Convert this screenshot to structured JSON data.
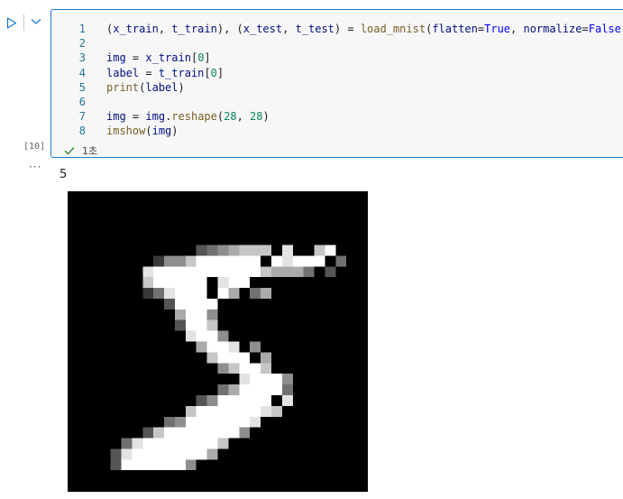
{
  "cell": {
    "execution_count": "[10]",
    "status_text": "1초",
    "lines": [
      {
        "no": "1",
        "tokens": [
          {
            "t": "(",
            "c": "op"
          },
          {
            "t": "x_train",
            "c": "var"
          },
          {
            "t": ", ",
            "c": "op"
          },
          {
            "t": "t_train",
            "c": "var"
          },
          {
            "t": "), (",
            "c": "op"
          },
          {
            "t": "x_test",
            "c": "var"
          },
          {
            "t": ", ",
            "c": "op"
          },
          {
            "t": "t_test",
            "c": "var"
          },
          {
            "t": ") = ",
            "c": "op"
          },
          {
            "t": "load_mnist",
            "c": "fn"
          },
          {
            "t": "(",
            "c": "op"
          },
          {
            "t": "flatten",
            "c": "var"
          },
          {
            "t": "=",
            "c": "op"
          },
          {
            "t": "True",
            "c": "kw"
          },
          {
            "t": ", ",
            "c": "op"
          },
          {
            "t": "normalize",
            "c": "var"
          },
          {
            "t": "=",
            "c": "op"
          },
          {
            "t": "False",
            "c": "kw"
          },
          {
            "t": ")",
            "c": "op"
          }
        ]
      },
      {
        "no": "2",
        "tokens": []
      },
      {
        "no": "3",
        "tokens": [
          {
            "t": "img",
            "c": "var"
          },
          {
            "t": " = ",
            "c": "op"
          },
          {
            "t": "x_train",
            "c": "var"
          },
          {
            "t": "[",
            "c": "op"
          },
          {
            "t": "0",
            "c": "num"
          },
          {
            "t": "]",
            "c": "op"
          }
        ]
      },
      {
        "no": "4",
        "tokens": [
          {
            "t": "label",
            "c": "var"
          },
          {
            "t": " = ",
            "c": "op"
          },
          {
            "t": "t_train",
            "c": "var"
          },
          {
            "t": "[",
            "c": "op"
          },
          {
            "t": "0",
            "c": "num"
          },
          {
            "t": "]",
            "c": "op"
          }
        ]
      },
      {
        "no": "5",
        "tokens": [
          {
            "t": "print",
            "c": "fn"
          },
          {
            "t": "(",
            "c": "op"
          },
          {
            "t": "label",
            "c": "var"
          },
          {
            "t": ")",
            "c": "op"
          }
        ]
      },
      {
        "no": "6",
        "tokens": []
      },
      {
        "no": "7",
        "tokens": [
          {
            "t": "img",
            "c": "var"
          },
          {
            "t": " = ",
            "c": "op"
          },
          {
            "t": "img",
            "c": "var"
          },
          {
            "t": ".",
            "c": "op"
          },
          {
            "t": "reshape",
            "c": "fn"
          },
          {
            "t": "(",
            "c": "op"
          },
          {
            "t": "28",
            "c": "num"
          },
          {
            "t": ", ",
            "c": "op"
          },
          {
            "t": "28",
            "c": "num"
          },
          {
            "t": ")",
            "c": "op"
          }
        ]
      },
      {
        "no": "8",
        "tokens": [
          {
            "t": "imshow",
            "c": "fn"
          },
          {
            "t": "(",
            "c": "op"
          },
          {
            "t": "img",
            "c": "var"
          },
          {
            "t": ")",
            "c": "op"
          }
        ]
      }
    ]
  },
  "output": {
    "more_label": "···",
    "printed_text": "5",
    "image_pixels": [
      "                            ",
      "                            ",
      "                            ",
      "                            ",
      "                            ",
      "            3456777 8  79   ",
      "        2557999999 98999 4  ",
      "       8999999999976664 3   ",
      "       799999 899          ",
      "       248999 96 46         ",
      "         39999              ",
      "          6995              ",
      "          3997              ",
      "           8995             ",
      "            6998 5          ",
      "             7999 6         ",
      "              57997         ",
      "                89995       ",
      "              4699994       ",
      "            3599999 8       ",
      "           799999987        ",
      "         459999998          ",
      "       3799999995           ",
      "     4899999997             ",
      "    3899999996              ",
      "    39999995                ",
      "                            ",
      "                            "
    ]
  },
  "colors": {
    "accent": "#1f7bd1",
    "success": "#388a34",
    "cell_bg": "#f7f7f7"
  },
  "icons": {
    "run": "play-triangle-icon",
    "collapse": "chevron-down-icon",
    "status": "checkmark-icon"
  }
}
